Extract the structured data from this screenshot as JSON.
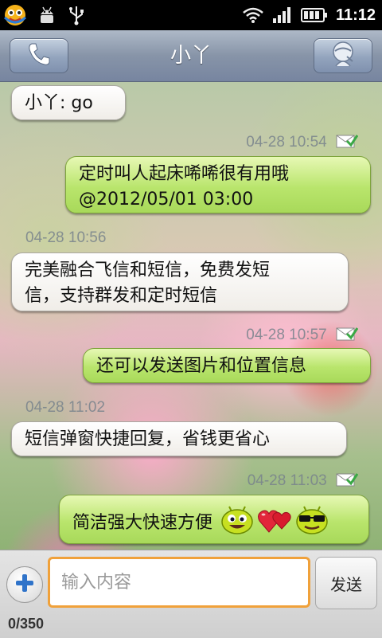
{
  "status_bar": {
    "time": "11:12"
  },
  "header": {
    "title": "小丫"
  },
  "messages": [
    {
      "kind": "in",
      "text": "小丫: go"
    },
    {
      "kind": "out",
      "timestamp": "04-28 10:54",
      "line1": "定时叫人起床唏唏很有用哦",
      "line2": "@2012/05/01 03:00"
    },
    {
      "kind": "in",
      "timestamp": "04-28 10:56",
      "line1": "完美融合飞信和短信，免费发短",
      "line2": "信，支持群发和定时短信"
    },
    {
      "kind": "out",
      "timestamp": "04-28 10:57",
      "text": "还可以发送图片和位置信息"
    },
    {
      "kind": "in",
      "timestamp": "04-28 11:02",
      "text": "短信弹窗快捷回复，省钱更省心"
    },
    {
      "kind": "out",
      "timestamp": "04-28 11:03",
      "text": "简洁强大快速方便"
    }
  ],
  "input": {
    "placeholder": "输入内容",
    "send_label": "发送",
    "counter": "0/350"
  },
  "icons": {
    "status_left": [
      "feixin-app-icon",
      "android-debug-icon",
      "usb-icon"
    ],
    "status_right": [
      "wifi-icon",
      "signal-icon",
      "battery-icon"
    ],
    "header_left": "phone-icon",
    "header_right": "contact-avatar-icon",
    "delivered": "delivered-check-icon",
    "emoji": [
      "android-smile-emoji-icon",
      "hearts-emoji-icon",
      "sunglasses-emoji-icon"
    ],
    "add": "plus-icon"
  }
}
